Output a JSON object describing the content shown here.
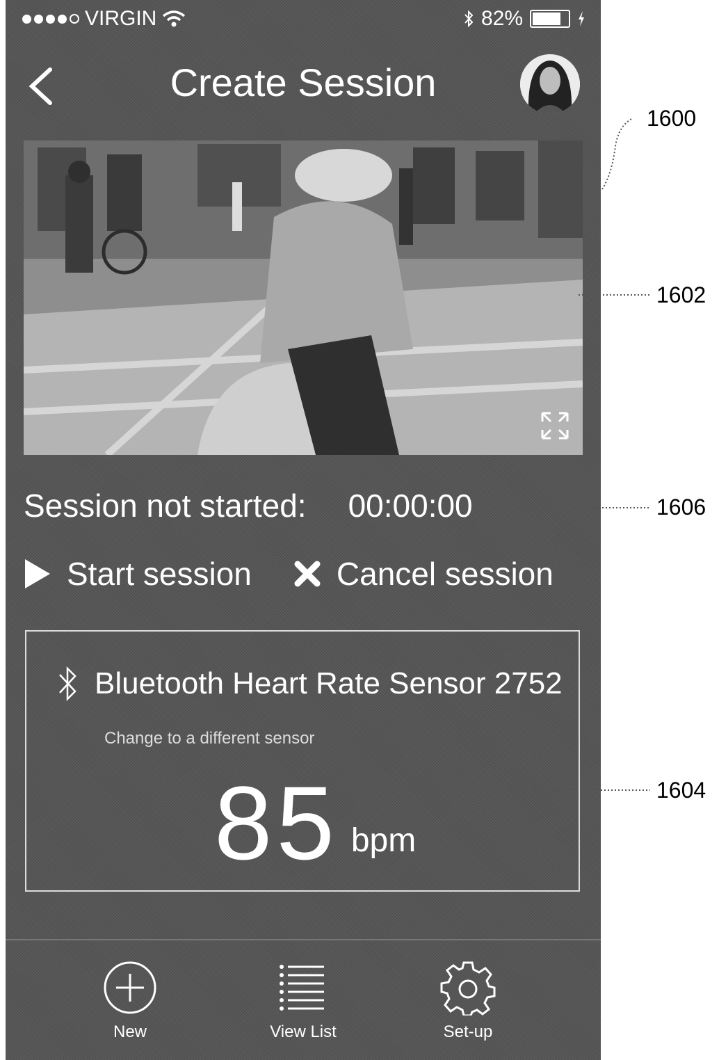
{
  "status_bar": {
    "carrier": "VIRGIN",
    "battery": "82%",
    "battery_level": 0.82
  },
  "nav": {
    "title": "Create Session"
  },
  "session": {
    "status_label": "Session not started:",
    "elapsed": "00:00:00",
    "start_label": "Start session",
    "cancel_label": "Cancel session"
  },
  "sensor": {
    "name": "Bluetooth Heart Rate Sensor 2752",
    "change_link": "Change to a different sensor",
    "heart_rate": "85",
    "unit": "bpm"
  },
  "tabs": [
    {
      "label": "New",
      "icon": "plus-circle-icon"
    },
    {
      "label": "View List",
      "icon": "list-icon"
    },
    {
      "label": "Set-up",
      "icon": "gear-icon"
    }
  ],
  "callouts": {
    "screen": "1600",
    "video": "1602",
    "timer": "1606",
    "sensor": "1604"
  }
}
